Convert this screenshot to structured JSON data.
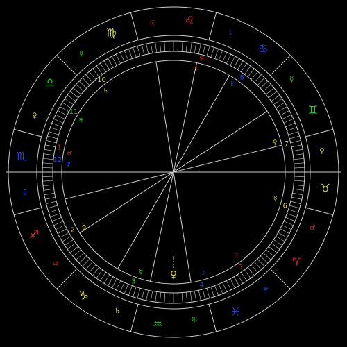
{
  "colors": {
    "background": "#000000",
    "lines": "#cfcfcf",
    "fire": "#e02020",
    "earth": "#d8d820",
    "air": "#20d020",
    "water": "#2040ff"
  },
  "signs": [
    {
      "glyph": "♉",
      "color": "#d8d820"
    },
    {
      "glyph": "♊",
      "color": "#20d020"
    },
    {
      "glyph": "♋",
      "color": "#2040ff"
    },
    {
      "glyph": "♌",
      "color": "#e02020"
    },
    {
      "glyph": "♍",
      "color": "#d8d820"
    },
    {
      "glyph": "♎",
      "color": "#20d020"
    },
    {
      "glyph": "♏",
      "color": "#2040ff"
    },
    {
      "glyph": "♐",
      "color": "#e02020"
    },
    {
      "glyph": "♑",
      "color": "#d8d820"
    },
    {
      "glyph": "♒",
      "color": "#20d020"
    },
    {
      "glyph": "♓",
      "color": "#2040ff"
    },
    {
      "glyph": "♈",
      "color": "#e02020"
    }
  ],
  "sign_rulers": [
    {
      "glyph": "♀",
      "color": "#d8d820"
    },
    {
      "glyph": "☿",
      "color": "#20d020"
    },
    {
      "glyph": "☽",
      "color": "#2040ff"
    },
    {
      "glyph": "☉",
      "color": "#e02020"
    },
    {
      "glyph": "☿",
      "color": "#20d020"
    },
    {
      "glyph": "♀",
      "color": "#d8d820"
    },
    {
      "glyph": "♇",
      "color": "#2040ff"
    },
    {
      "glyph": "♃",
      "color": "#e02020"
    },
    {
      "glyph": "♄",
      "color": "#d8d820"
    },
    {
      "glyph": "♅",
      "color": "#20d020"
    },
    {
      "glyph": "♆",
      "color": "#2040ff"
    },
    {
      "glyph": "♂",
      "color": "#e02020"
    }
  ],
  "houses": [
    {
      "number": "1",
      "color": "#e02020",
      "ruler": "♂",
      "ruler_color": "#e02020"
    },
    {
      "number": "2",
      "color": "#d8d820",
      "ruler": "♀",
      "ruler_color": "#d8d820"
    },
    {
      "number": "3",
      "color": "#20d020",
      "ruler": "☿",
      "ruler_color": "#20d020"
    },
    {
      "number": "4",
      "color": "#2040ff",
      "ruler": "☽",
      "ruler_color": "#2040ff"
    },
    {
      "number": "5",
      "color": "#e02020",
      "ruler": "☉",
      "ruler_color": "#e02020"
    },
    {
      "number": "6",
      "color": "#d8d820",
      "ruler": "☿",
      "ruler_color": "#d8d820"
    },
    {
      "number": "7",
      "color": "#d8d820",
      "ruler": "♀",
      "ruler_color": "#d8d820"
    },
    {
      "number": "8",
      "color": "#2040ff",
      "ruler": "♇",
      "ruler_color": "#2040ff"
    },
    {
      "number": "9",
      "color": "#e02020",
      "ruler": "♃",
      "ruler_color": "#e02020"
    },
    {
      "number": "10",
      "color": "#d8d820",
      "ruler": "♄",
      "ruler_color": "#d8d820"
    },
    {
      "number": "11",
      "color": "#20d020",
      "ruler": "♅",
      "ruler_color": "#20d020"
    },
    {
      "number": "12",
      "color": "#2040ff",
      "ruler": "♆",
      "ruler_color": "#2040ff"
    }
  ],
  "planet": {
    "glyph": "♀",
    "color": "#d8d820",
    "marker": "i"
  }
}
